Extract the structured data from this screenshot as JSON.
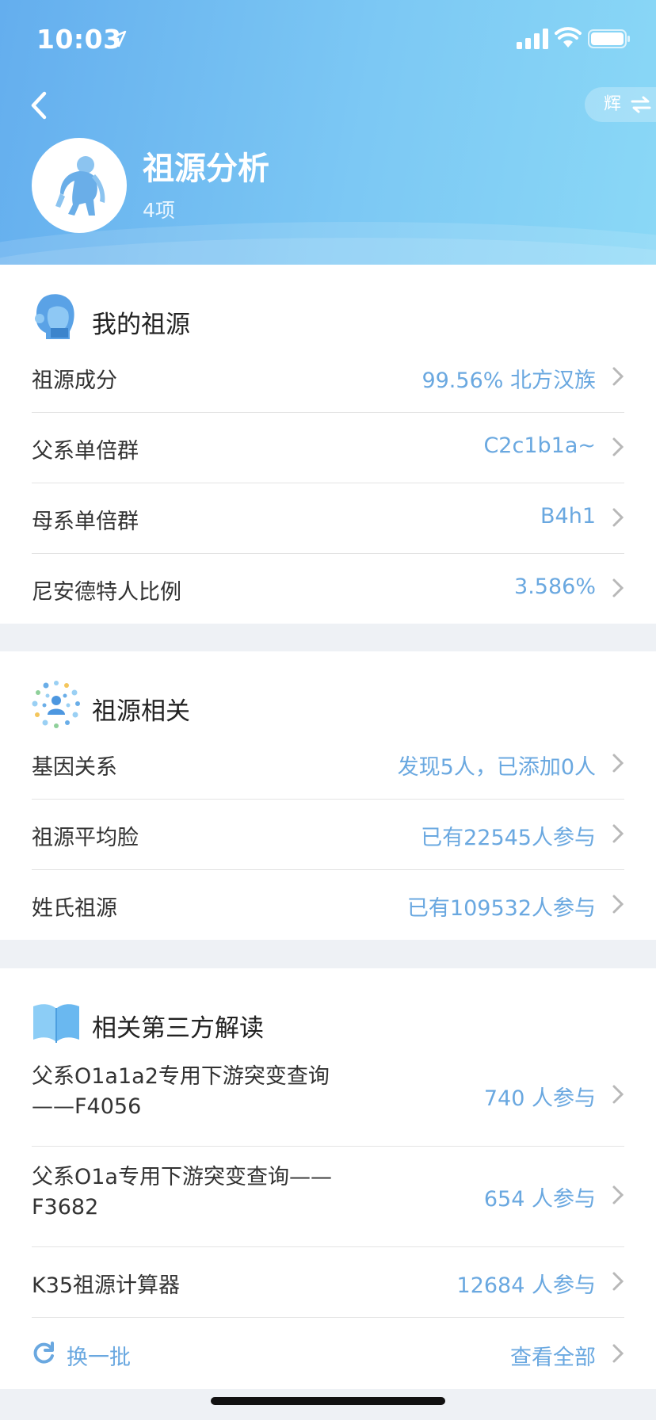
{
  "status_bar": {
    "time": "10:03"
  },
  "header": {
    "switch_label": "辉",
    "title": "祖源分析",
    "subtitle": "4项"
  },
  "sections": [
    {
      "title": "我的祖源",
      "icon": "face-icon",
      "rows": [
        {
          "label": "祖源成分",
          "value": "99.56% 北方汉族"
        },
        {
          "label": "父系单倍群",
          "value": "C2c1b1a~"
        },
        {
          "label": "母系单倍群",
          "value": "B4h1"
        },
        {
          "label": "尼安德特人比例",
          "value": "3.586%"
        }
      ]
    },
    {
      "title": "祖源相关",
      "icon": "network-icon",
      "rows": [
        {
          "label": "基因关系",
          "value": "发现5人，已添加0人"
        },
        {
          "label": "祖源平均脸",
          "value": "已有22545人参与"
        },
        {
          "label": "姓氏祖源",
          "value": "已有109532人参与"
        }
      ]
    },
    {
      "title": "相关第三方解读",
      "icon": "book-icon",
      "rows": [
        {
          "label_line1": "父系O1a1a2专用下游突变查询",
          "label_line2": "——F4056",
          "value": "740 人参与"
        },
        {
          "label_line1": "父系O1a专用下游突变查询——",
          "label_line2": "F3682",
          "value": "654 人参与"
        },
        {
          "label": "K35祖源计算器",
          "value": "12684 人参与"
        }
      ],
      "footer": {
        "refresh_label": "换一批",
        "view_all_label": "查看全部"
      }
    }
  ],
  "colors": {
    "accent": "#6aa8e0",
    "header_start": "#64aeee",
    "header_end": "#8ad8f6"
  }
}
